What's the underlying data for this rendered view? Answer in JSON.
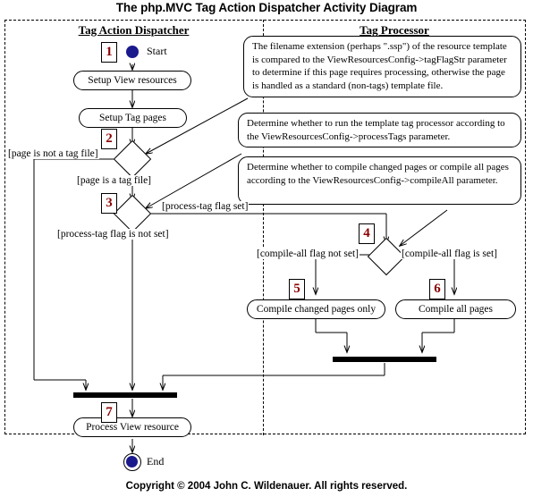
{
  "title": "The php.MVC Tag Action Dispatcher Activity Diagram",
  "footer": "Copyright © 2004 John C. Wildenauer.  All rights reserved.",
  "lanes": [
    {
      "name": "Tag Action Dispatcher"
    },
    {
      "name": "Tag Processor"
    }
  ],
  "nodes": {
    "start_label": "Start",
    "end_label": "End",
    "setup_view_resources": "Setup View resources",
    "setup_tag_pages": "Setup Tag pages",
    "compile_changed_pages": "Compile changed pages only",
    "compile_all_pages": "Compile all pages",
    "process_view_resource": "Process View resource"
  },
  "guards": {
    "page_is_not_tag_file": "[page is not a tag file]",
    "page_is_a_tag_file": "[page is a tag file]",
    "process_tag_flag_set": "[process-tag flag set]",
    "process_tag_flag_not_set": "[process-tag flag is not set]",
    "compile_all_flag_not_set": "[compile-all flag not set]",
    "compile_all_flag_is_set": "[compile-all flag is set]"
  },
  "steps": {
    "s1": "1",
    "s2": "2",
    "s3": "3",
    "s4": "4",
    "s5": "5",
    "s6": "6",
    "s7": "7"
  },
  "notes": {
    "note1": "The filename extension (perhaps \".ssp\") of the resource template is compared to the ViewResourcesConfig->tagFlagStr parameter to determine if this page requires processing, otherwise the page is handled as a standard (non-tags) template file.",
    "note2": "Determine whether to run the template tag processor according to the ViewResourcesConfig->processTags parameter.",
    "note3": "Determine whether to compile changed pages or compile all pages according to the ViewResourcesConfig->compileAll parameter."
  },
  "colors": {
    "step_number": "#8b0000",
    "node_fill": "#1a1a8c",
    "line": "#000000",
    "background": "#ffffff"
  }
}
